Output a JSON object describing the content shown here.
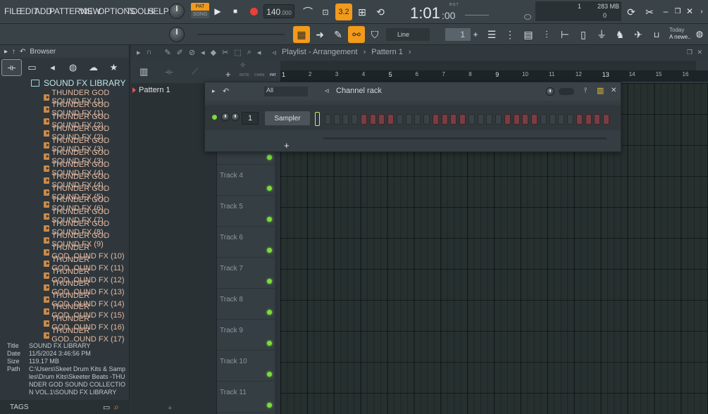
{
  "menu": [
    "FILE",
    "EDIT",
    "ADD",
    "PATTERNS",
    "VIEW",
    "OPTIONS",
    "TOOLS",
    "HELP"
  ],
  "transport": {
    "pat_label": "PAT",
    "song_label": "SONG",
    "tempo": "140",
    "tempo_dec": ".000",
    "time": "1:01",
    "time_sub": ":00",
    "time_units": "B:S:T",
    "step_label": "3.2"
  },
  "monitor": {
    "voices": "1",
    "memory": "283 MB",
    "cpu": "0"
  },
  "toolbar2": {
    "snap": "Line",
    "pattern_num": "1",
    "news_title": "Today",
    "news_text": "A newe.."
  },
  "browser": {
    "title": "Browser",
    "library": "SOUND FX LIBRARY",
    "files": [
      "THUNDER GOD SOUND FX (1)",
      "THUNDER GOD SOUND FX (1)",
      "THUNDER GOD SOUND FX (2)",
      "THUNDER GOD SOUND FX (2)",
      "THUNDER GOD SOUND FX (3)",
      "THUNDER GOD SOUND FX (3)",
      "THUNDER GOD SOUND FX (4)",
      "THUNDER GOD SOUND FX (4)",
      "THUNDER GOD SOUND FX (5)",
      "THUNDER GOD SOUND FX (6)",
      "THUNDER GOD SOUND FX (7)",
      "THUNDER GOD SOUND FX (8)",
      "THUNDER GOD SOUND FX (9)",
      "THUNDER GOD..OUND FX (10)",
      "THUNDER GOD..OUND FX (11)",
      "THUNDER GOD..OUND FX (12)",
      "THUNDER GOD..OUND FX (13)",
      "THUNDER GOD..OUND FX (14)",
      "THUNDER GOD..OUND FX (15)",
      "THUNDER GOD..OUND FX (16)",
      "THUNDER GOD..OUND FX (17)"
    ],
    "info": {
      "title_k": "Title",
      "title_v": "SOUND FX LIBRARY",
      "date_k": "Date",
      "date_v": "11/5/2024 3:46:56 PM",
      "size_k": "Size",
      "size_v": "119.17 MB",
      "path_k": "Path",
      "path_v": "C:\\Users\\Skeet Drum Kits & Samples\\Drum Kits\\Skeeter Beats -THUNDER GOD SOUND COLLECTION VOL.1\\SOUND FX LIBRARY"
    },
    "tags_label": "TAGS"
  },
  "playlist": {
    "title": "Playlist - Arrangement",
    "sep": "›",
    "pattern": "Pattern 1",
    "pattern_item": "Pattern 1",
    "tab_note": "NOTE",
    "tab_chan": "CHAN",
    "tab_pat": "PAT",
    "bars": [
      "1",
      "2",
      "3",
      "4",
      "5",
      "6",
      "7",
      "8",
      "9",
      "10",
      "11",
      "12",
      "13",
      "14",
      "15",
      "16"
    ],
    "tracks": [
      "Track 4",
      "Track 5",
      "Track 6",
      "Track 7",
      "Track 8",
      "Track 9",
      "Track 10",
      "Track 11"
    ]
  },
  "rack": {
    "title": "Channel rack",
    "filter": "All",
    "channel_number": "1",
    "channel_name": "Sampler",
    "add_label": "+",
    "steps": [
      0,
      0,
      0,
      0,
      1,
      1,
      1,
      1,
      0,
      0,
      0,
      0,
      1,
      1,
      1,
      1,
      0,
      0,
      0,
      0,
      1,
      1,
      1,
      1,
      0,
      0,
      0,
      0,
      1,
      1,
      1,
      1
    ]
  }
}
